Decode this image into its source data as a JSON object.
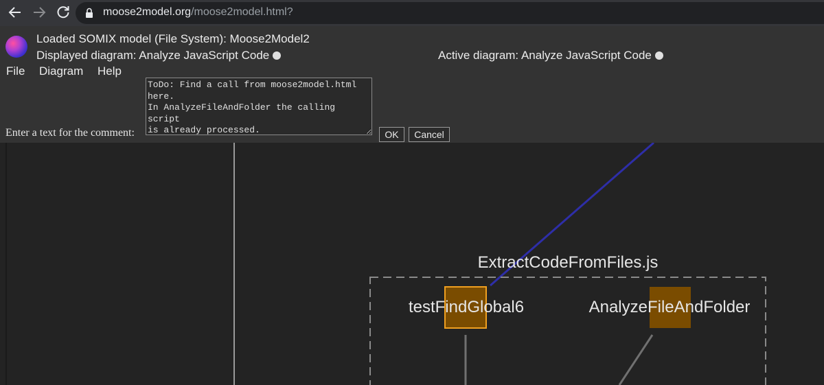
{
  "browser": {
    "back_icon": "arrow-left-icon",
    "forward_icon": "arrow-right-icon",
    "reload_icon": "reload-icon",
    "lock_icon": "lock-icon",
    "url_domain": "moose2model.org",
    "url_path": "/moose2model.html?"
  },
  "header": {
    "logo_icon": "moose2model-logo",
    "loaded_model": "Loaded SOMIX model (File System): Moose2Model2",
    "displayed_diagram": "Displayed diagram: Analyze JavaScript Code",
    "active_diagram": "Active diagram: Analyze JavaScript Code"
  },
  "menu": {
    "items": [
      {
        "label": "File"
      },
      {
        "label": "Diagram"
      },
      {
        "label": "Help"
      }
    ]
  },
  "comment": {
    "label": "Enter a text for the comment:",
    "text": "ToDo: Find a call from moose2model.html\nhere.\nIn AnalyzeFileAndFolder the calling script\nis already processed.\nWhy is the usage not found?",
    "ok_label": "OK",
    "cancel_label": "Cancel"
  },
  "diagram": {
    "group_title": "ExtractCodeFromFiles.js",
    "nodes": [
      {
        "label": "testFindGlobal6",
        "selected": true
      },
      {
        "label": "AnalyzeFileAndFolder",
        "selected": false
      }
    ],
    "colors": {
      "background": "#232323",
      "node_fill": "#7a4c00",
      "node_selected_border": "#f0a020",
      "link_blue": "#3030b0",
      "link_gray": "#707070",
      "group_border": "#8a8a8a"
    }
  }
}
